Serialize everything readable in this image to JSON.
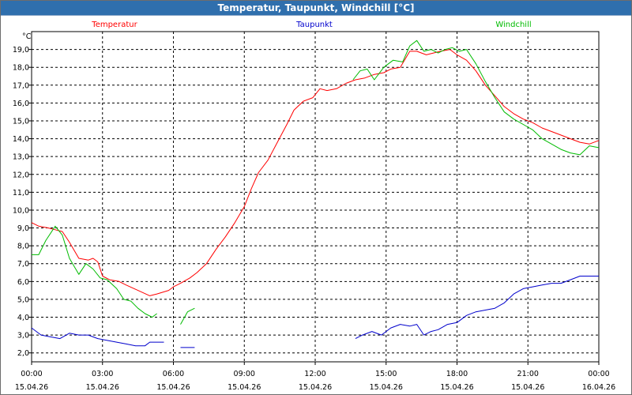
{
  "window": {
    "title": "Temperatur, Taupunkt, Windchill [°C]"
  },
  "chart_data": {
    "type": "line",
    "title": "Temperatur, Taupunkt, Windchill [°C]",
    "ylabel": "°C",
    "xlabel": "",
    "ylim": [
      1.5,
      20.0
    ],
    "xlim": [
      0,
      24
    ],
    "grid": true,
    "legend_position": "top",
    "yticks": [
      2.0,
      3.0,
      4.0,
      5.0,
      6.0,
      7.0,
      8.0,
      9.0,
      10.0,
      11.0,
      12.0,
      13.0,
      14.0,
      15.0,
      16.0,
      17.0,
      18.0,
      19.0
    ],
    "ytick_labels": [
      "2,0",
      "3,0",
      "4,0",
      "5,0",
      "6,0",
      "7,0",
      "8,0",
      "9,0",
      "10,0",
      "11,0",
      "12,0",
      "13,0",
      "14,0",
      "15,0",
      "16,0",
      "17,0",
      "18,0",
      "19,0"
    ],
    "xticks": [
      {
        "time": "00:00",
        "date": "15.04.26"
      },
      {
        "time": "03:00",
        "date": "15.04.26"
      },
      {
        "time": "06:00",
        "date": "15.04.26"
      },
      {
        "time": "09:00",
        "date": "15.04.26"
      },
      {
        "time": "12:00",
        "date": "15.04.26"
      },
      {
        "time": "15:00",
        "date": "15.04.26"
      },
      {
        "time": "18:00",
        "date": "15.04.26"
      },
      {
        "time": "21:00",
        "date": "15.04.26"
      },
      {
        "time": "00:00",
        "date": "16.04.26"
      }
    ],
    "series": [
      {
        "name": "Temperatur",
        "color": "#ff0000",
        "segments": [
          [
            [
              0.0,
              9.3
            ],
            [
              0.3,
              9.1
            ],
            [
              0.7,
              9.0
            ],
            [
              1.0,
              8.9
            ],
            [
              1.3,
              8.8
            ],
            [
              1.6,
              8.2
            ],
            [
              2.0,
              7.3
            ],
            [
              2.4,
              7.2
            ],
            [
              2.6,
              7.3
            ],
            [
              2.8,
              7.1
            ],
            [
              3.0,
              6.3
            ],
            [
              3.3,
              6.1
            ],
            [
              3.7,
              6.0
            ],
            [
              4.0,
              5.8
            ],
            [
              4.5,
              5.5
            ],
            [
              5.0,
              5.2
            ],
            [
              5.3,
              5.3
            ],
            [
              5.8,
              5.5
            ],
            [
              6.0,
              5.7
            ],
            [
              6.3,
              5.9
            ],
            [
              6.7,
              6.2
            ],
            [
              7.0,
              6.5
            ],
            [
              7.4,
              7.0
            ],
            [
              7.8,
              7.8
            ],
            [
              8.2,
              8.5
            ],
            [
              8.6,
              9.3
            ],
            [
              9.0,
              10.2
            ],
            [
              9.3,
              11.2
            ],
            [
              9.6,
              12.1
            ],
            [
              10.0,
              12.8
            ],
            [
              10.4,
              13.8
            ],
            [
              10.8,
              14.8
            ],
            [
              11.1,
              15.6
            ],
            [
              11.5,
              16.1
            ],
            [
              11.9,
              16.3
            ],
            [
              12.2,
              16.8
            ],
            [
              12.5,
              16.7
            ],
            [
              12.9,
              16.8
            ],
            [
              13.3,
              17.1
            ],
            [
              13.7,
              17.3
            ],
            [
              14.1,
              17.4
            ],
            [
              14.5,
              17.6
            ],
            [
              14.9,
              17.7
            ],
            [
              15.2,
              17.9
            ],
            [
              15.6,
              18.0
            ],
            [
              16.0,
              18.9
            ],
            [
              16.3,
              18.9
            ],
            [
              16.7,
              18.7
            ],
            [
              17.0,
              18.8
            ],
            [
              17.3,
              18.9
            ],
            [
              17.7,
              19.0
            ],
            [
              18.0,
              18.7
            ],
            [
              18.4,
              18.4
            ],
            [
              18.8,
              17.8
            ],
            [
              19.2,
              17.0
            ],
            [
              19.6,
              16.4
            ],
            [
              20.0,
              15.8
            ],
            [
              20.4,
              15.4
            ],
            [
              20.8,
              15.1
            ],
            [
              21.2,
              14.9
            ],
            [
              21.6,
              14.6
            ],
            [
              22.0,
              14.4
            ],
            [
              22.4,
              14.2
            ],
            [
              22.8,
              14.0
            ],
            [
              23.2,
              13.8
            ],
            [
              23.6,
              13.7
            ],
            [
              24.0,
              13.9
            ]
          ]
        ]
      },
      {
        "name": "Taupunkt",
        "color": "#0000cc",
        "segments": [
          [
            [
              0.0,
              3.4
            ],
            [
              0.4,
              3.0
            ],
            [
              0.8,
              2.9
            ],
            [
              1.2,
              2.8
            ],
            [
              1.6,
              3.1
            ],
            [
              2.0,
              3.0
            ],
            [
              2.4,
              3.0
            ],
            [
              2.8,
              2.8
            ],
            [
              3.2,
              2.7
            ],
            [
              3.6,
              2.6
            ],
            [
              4.0,
              2.5
            ],
            [
              4.4,
              2.4
            ],
            [
              4.8,
              2.4
            ],
            [
              5.0,
              2.6
            ],
            [
              5.4,
              2.6
            ],
            [
              5.6,
              2.6
            ]
          ],
          [
            [
              6.3,
              2.3
            ],
            [
              6.6,
              2.3
            ],
            [
              6.9,
              2.3
            ]
          ],
          [
            [
              13.7,
              2.8
            ],
            [
              14.0,
              3.0
            ],
            [
              14.4,
              3.2
            ],
            [
              14.8,
              3.0
            ],
            [
              15.2,
              3.4
            ],
            [
              15.6,
              3.6
            ],
            [
              16.0,
              3.5
            ],
            [
              16.3,
              3.6
            ],
            [
              16.6,
              3.0
            ],
            [
              16.9,
              3.2
            ],
            [
              17.2,
              3.3
            ],
            [
              17.6,
              3.6
            ],
            [
              18.0,
              3.7
            ],
            [
              18.4,
              4.1
            ],
            [
              18.8,
              4.3
            ],
            [
              19.2,
              4.4
            ],
            [
              19.6,
              4.5
            ],
            [
              20.0,
              4.8
            ],
            [
              20.4,
              5.3
            ],
            [
              20.8,
              5.6
            ],
            [
              21.2,
              5.7
            ],
            [
              21.6,
              5.8
            ],
            [
              22.0,
              5.9
            ],
            [
              22.4,
              5.9
            ],
            [
              22.8,
              6.1
            ],
            [
              23.2,
              6.3
            ],
            [
              23.6,
              6.3
            ],
            [
              24.0,
              6.3
            ]
          ]
        ]
      },
      {
        "name": "Windchill",
        "color": "#00bb00",
        "segments": [
          [
            [
              0.0,
              7.5
            ],
            [
              0.3,
              7.5
            ],
            [
              0.6,
              8.3
            ],
            [
              1.0,
              9.1
            ],
            [
              1.3,
              8.6
            ],
            [
              1.6,
              7.3
            ],
            [
              2.0,
              6.4
            ],
            [
              2.3,
              7.0
            ],
            [
              2.6,
              6.7
            ],
            [
              2.9,
              6.2
            ],
            [
              3.2,
              6.1
            ],
            [
              3.6,
              5.6
            ],
            [
              3.9,
              5.0
            ],
            [
              4.2,
              4.9
            ],
            [
              4.5,
              4.5
            ],
            [
              4.8,
              4.2
            ],
            [
              5.1,
              4.0
            ],
            [
              5.3,
              4.2
            ]
          ],
          [
            [
              6.3,
              3.6
            ],
            [
              6.6,
              4.3
            ],
            [
              6.9,
              4.5
            ]
          ],
          [
            [
              13.6,
              17.3
            ],
            [
              13.9,
              17.8
            ],
            [
              14.2,
              17.9
            ],
            [
              14.5,
              17.3
            ],
            [
              14.9,
              18.0
            ],
            [
              15.3,
              18.4
            ],
            [
              15.7,
              18.3
            ],
            [
              16.0,
              19.2
            ],
            [
              16.3,
              19.5
            ],
            [
              16.6,
              18.9
            ],
            [
              16.9,
              19.0
            ],
            [
              17.2,
              18.8
            ],
            [
              17.5,
              19.0
            ],
            [
              17.8,
              19.1
            ],
            [
              18.1,
              18.9
            ],
            [
              18.4,
              19.0
            ],
            [
              18.8,
              18.2
            ],
            [
              19.2,
              17.2
            ],
            [
              19.6,
              16.3
            ],
            [
              20.0,
              15.5
            ],
            [
              20.4,
              15.1
            ],
            [
              20.8,
              14.8
            ],
            [
              21.2,
              14.5
            ],
            [
              21.6,
              14.0
            ],
            [
              22.0,
              13.7
            ],
            [
              22.4,
              13.4
            ],
            [
              22.8,
              13.2
            ],
            [
              23.2,
              13.1
            ],
            [
              23.6,
              13.6
            ],
            [
              24.0,
              13.5
            ]
          ]
        ]
      }
    ]
  }
}
